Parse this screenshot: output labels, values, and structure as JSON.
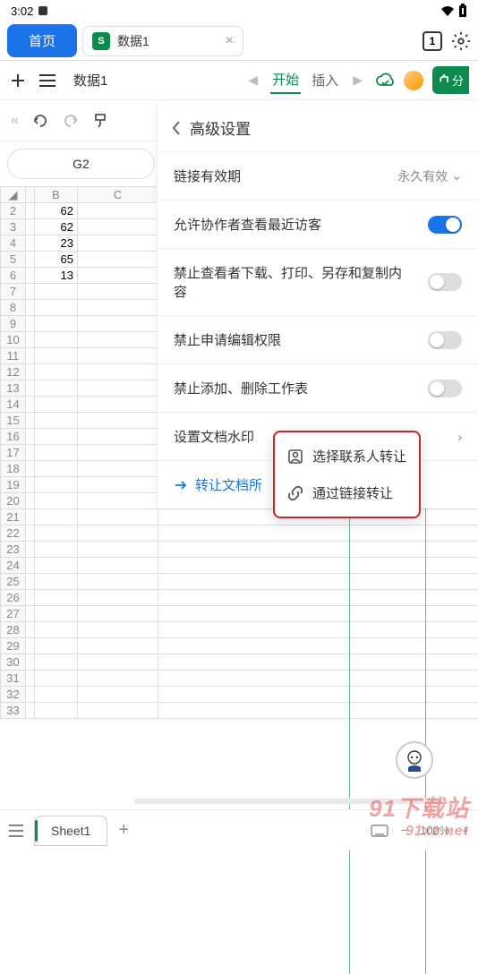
{
  "status": {
    "time": "3:02",
    "tab_count": "1"
  },
  "tabs": {
    "home": "首页",
    "doc_title": "数据1",
    "doc_icon": "S"
  },
  "toolbar": {
    "doc_name": "数据1",
    "menu_start": "开始",
    "menu_insert": "插入"
  },
  "cell_ref": "G2",
  "sheet": {
    "cols": [
      "B",
      "C"
    ],
    "rows": [
      2,
      3,
      4,
      5,
      6,
      7,
      8,
      9,
      10,
      11,
      12,
      13,
      14,
      15,
      16,
      17,
      18,
      19,
      20,
      21,
      22,
      23,
      24,
      25,
      26,
      27,
      28,
      29,
      30,
      31,
      32,
      33
    ],
    "data": {
      "2": "62",
      "3": "62",
      "4": "23",
      "5": "65",
      "6": "13"
    }
  },
  "settings": {
    "title": "高级设置",
    "link_expiry_label": "链接有效期",
    "link_expiry_value": "永久有效",
    "allow_collaborator": "允许协作者查看最近访客",
    "forbid_viewer": "禁止查看者下载、打印、另存和复制内容",
    "forbid_request_edit": "禁止申请编辑权限",
    "forbid_sheets": "禁止添加、删除工作表",
    "watermark": "设置文档水印",
    "transfer": "转让文档所"
  },
  "popup": {
    "contact": "选择联系人转让",
    "link": "通过链接转让"
  },
  "bottom": {
    "sheet_tab": "Sheet1",
    "zoom": "100%"
  },
  "watermark_text": "91下载站",
  "watermark_url": "91xz.net"
}
